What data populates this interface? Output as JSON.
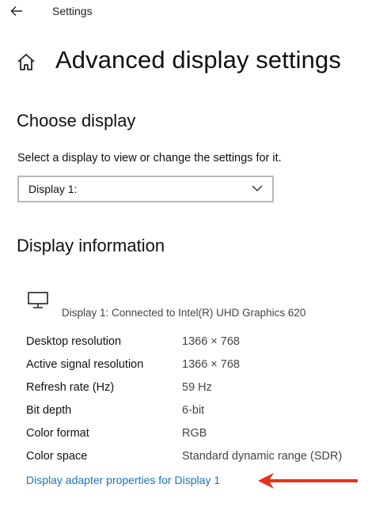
{
  "titlebar": {
    "back_icon": "back-arrow-icon",
    "title": "Settings"
  },
  "header": {
    "home_icon": "home-icon",
    "title": "Advanced display settings"
  },
  "choose_display": {
    "heading": "Choose display",
    "description": "Select a display to view or change the settings for it.",
    "select": {
      "value": "Display 1:",
      "chevron_icon": "chevron-down-icon"
    }
  },
  "display_information": {
    "heading": "Display information",
    "monitor_icon": "monitor-icon",
    "connection": "Display 1: Connected to Intel(R) UHD Graphics 620",
    "rows": [
      {
        "label": "Desktop resolution",
        "value": "1366 × 768"
      },
      {
        "label": "Active signal resolution",
        "value": "1366 × 768"
      },
      {
        "label": "Refresh rate (Hz)",
        "value": "59 Hz"
      },
      {
        "label": "Bit depth",
        "value": "6-bit"
      },
      {
        "label": "Color format",
        "value": "RGB"
      },
      {
        "label": "Color space",
        "value": "Standard dynamic range (SDR)"
      }
    ],
    "adapter_link": "Display adapter properties for Display 1"
  },
  "annotation": {
    "arrow_icon": "red-arrow-icon",
    "arrow_color": "#e8321a"
  },
  "colors": {
    "link": "#1a73b5"
  }
}
